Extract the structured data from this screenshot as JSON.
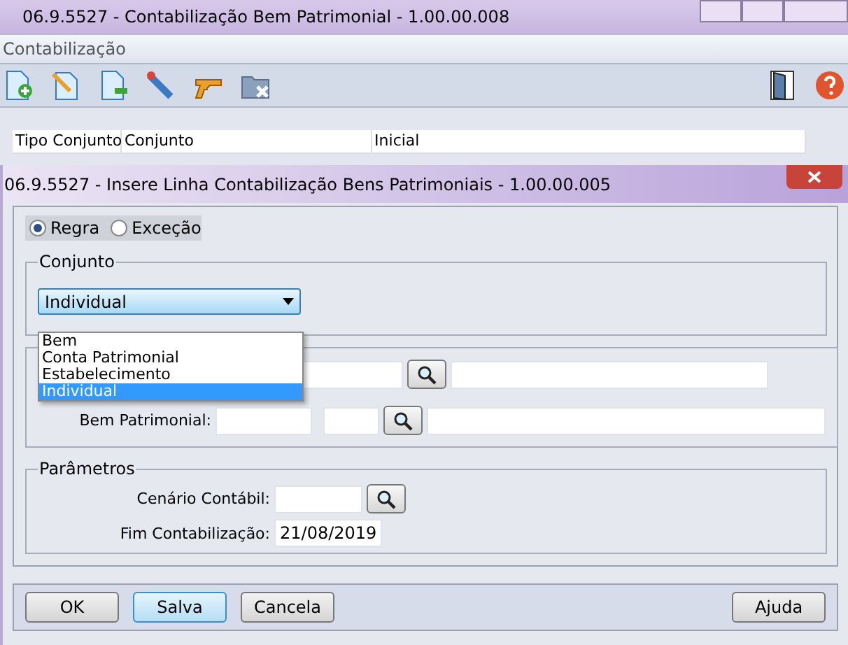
{
  "back_window": {
    "title": "06.9.5527 - Contabilização Bem Patrimonial - 1.00.00.008",
    "menu": "Contabilização",
    "toolbar": [
      {
        "kind": "add"
      },
      {
        "kind": "edit"
      },
      {
        "kind": "remove"
      },
      {
        "kind": "pen"
      },
      {
        "kind": "gun"
      },
      {
        "kind": "folder-x"
      }
    ],
    "toolbar_right": [
      {
        "kind": "door"
      },
      {
        "kind": "help"
      }
    ],
    "table": {
      "columns": [
        "Tipo Conjunto",
        "Conjunto",
        "Inicial"
      ]
    }
  },
  "dialog": {
    "title": "06.9.5527 - Insere Linha Contabilização Bens Patrimoniais - 1.00.00.005",
    "mode": [
      {
        "label": "Regra",
        "selected": true
      },
      {
        "label": "Exceção",
        "selected": false
      }
    ],
    "conjunto": {
      "legend": "Conjunto",
      "value": "Individual",
      "expanded": true,
      "options": [
        {
          "label": "Bem",
          "selected": false
        },
        {
          "label": "Conta Patrimonial",
          "selected": false
        },
        {
          "label": "Estabelecimento",
          "selected": false
        },
        {
          "label": "Individual",
          "selected": true
        }
      ]
    },
    "bem_patrimonial": {
      "label": "Bem Patrimonial:"
    },
    "parametros": {
      "legend": "Parâmetros",
      "cenario": {
        "label": "Cenário Contábil:"
      },
      "fim": {
        "label": "Fim Contabilização:",
        "value": "21/08/2019"
      }
    },
    "buttons": [
      {
        "label": "OK",
        "default": false
      },
      {
        "label": "Salva",
        "default": true
      },
      {
        "label": "Cancela",
        "default": false
      }
    ],
    "help_button": "Ajuda"
  }
}
